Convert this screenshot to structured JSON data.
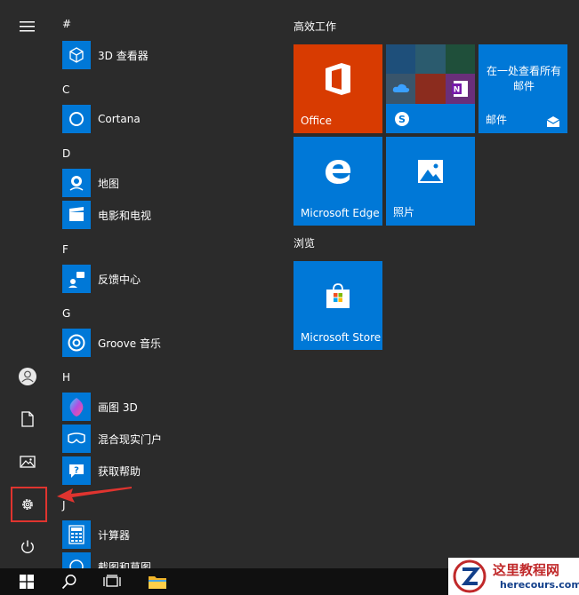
{
  "colors": {
    "background": "#2b2b2b",
    "accent": "#0078d7",
    "office": "#d83b01",
    "highlight": "#e0342f"
  },
  "rail": {
    "menu_icon": "hamburger-icon",
    "items": [
      "user-icon",
      "document-icon",
      "pictures-icon",
      "settings-icon",
      "power-icon"
    ]
  },
  "applist": {
    "headers": {
      "hash": "#",
      "c": "C",
      "d": "D",
      "f": "F",
      "g": "G",
      "h": "H",
      "j": "J"
    },
    "apps": {
      "viewer3d": "3D 查看器",
      "cortana": "Cortana",
      "maps": "地图",
      "movies": "电影和电视",
      "feedback": "反馈中心",
      "groove": "Groove 音乐",
      "paint3d": "画图 3D",
      "mixedreality": "混合现实门户",
      "gethelp": "获取帮助",
      "calculator": "计算器",
      "snip": "截图和草图"
    }
  },
  "tiles": {
    "group1": "高效工作",
    "group2": "浏览",
    "office": "Office",
    "mail_text": "在一处查看所有邮件",
    "mail": "邮件",
    "edge": "Microsoft Edge",
    "photos": "照片",
    "store": "Microsoft Store"
  },
  "watermark": {
    "title": "这里教程网",
    "site": "herecours.com"
  }
}
